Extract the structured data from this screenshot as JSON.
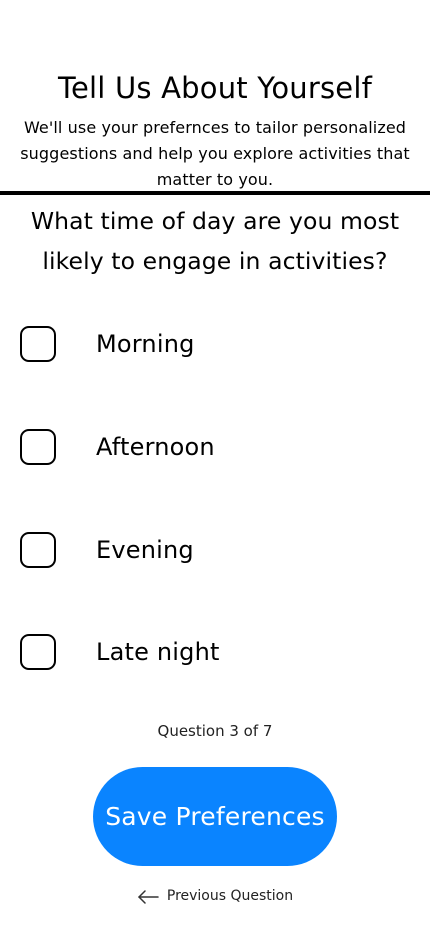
{
  "header": {
    "title": "Tell Us About Yourself",
    "subtitle": "We'll use your prefernces to tailor personalized suggestions and help you explore activities that matter to you."
  },
  "question": {
    "text": "What time of day are you most likely to engage in activities?"
  },
  "options": [
    {
      "label": "Morning",
      "checked": false
    },
    {
      "label": "Afternoon",
      "checked": false
    },
    {
      "label": "Evening",
      "checked": false
    },
    {
      "label": "Late night",
      "checked": false
    }
  ],
  "progress": {
    "text": "Question 3 of 7"
  },
  "actions": {
    "save_label": "Save Preferences",
    "previous_label": "Previous Question",
    "previous_icon": "arrow-left-icon"
  },
  "colors": {
    "accent": "#0a84ff",
    "text": "#000000",
    "background": "#ffffff"
  }
}
